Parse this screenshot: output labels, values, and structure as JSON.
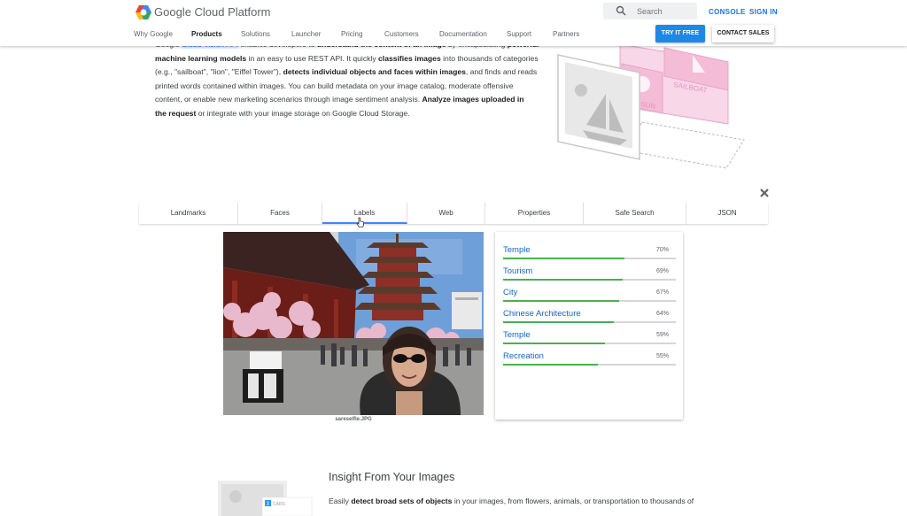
{
  "header": {
    "brand": "Google Cloud Platform",
    "search_placeholder": "Search",
    "console": "CONSOLE",
    "sign_in": "SIGN IN",
    "nav": [
      "Why Google",
      "Products",
      "Solutions",
      "Launcher",
      "Pricing",
      "Customers",
      "Documentation",
      "Support",
      "Partners"
    ],
    "active_nav": "Products",
    "try_free": "TRY IT FREE",
    "contact_sales": "CONTACT SALES"
  },
  "intro": {
    "l1a": "Google ",
    "l1b": "Cloud Vision API",
    "l1c": " enables developers to ",
    "l1d": "understand the content of an image",
    "l1e": " by encapsulating ",
    "l1f": "powerful",
    "l2a": "machine learning models",
    "l2b": " in an easy to use REST API. It quickly ",
    "l2c": "classifies images",
    "l2d": " into thousands of categories",
    "l3a": "(e.g., \"sailboat\", \"lion\", \"Eiffel Tower\"), ",
    "l3b": "detects individual objects and faces within images",
    "l3c": ", and finds and reads",
    "l4": "printed words contained within images. You can build metadata on your image catalog, moderate offensive",
    "l5a": "content, or enable new marketing scenarios through image sentiment analysis. ",
    "l5b": "Analyze images uploaded in",
    "l6a": "the request",
    "l6b": " or integrate with your image storage on Google Cloud Storage."
  },
  "illustration": {
    "sun": "SUN",
    "sailboat": "SAILBOAT"
  },
  "tabs": [
    "Landmarks",
    "Faces",
    "Labels",
    "Web",
    "Properties",
    "Safe Search",
    "JSON"
  ],
  "active_tab": "Labels",
  "photo": {
    "caption": "sareselfie.JPG"
  },
  "labels": [
    {
      "name": "Temple",
      "percent": "70%",
      "score": 0.7
    },
    {
      "name": "Tourism",
      "percent": "69%",
      "score": 0.69
    },
    {
      "name": "City",
      "percent": "67%",
      "score": 0.67
    },
    {
      "name": "Chinese Architecture",
      "percent": "64%",
      "score": 0.64
    },
    {
      "name": "Temple",
      "percent": "59%",
      "score": 0.59
    },
    {
      "name": "Recreation",
      "percent": "55%",
      "score": 0.55
    }
  ],
  "insight": {
    "title": "Insight From Your Images",
    "body_a": "Easily ",
    "body_b": "detect broad sets of objects",
    "body_c": " in your images, from flowers, animals, or transportation to thousands of",
    "mini_badge": "3",
    "mini_text": "CARS"
  },
  "colors": {
    "accent": "#1e88e5",
    "link": "#1565c0",
    "bar": "#4caf50",
    "tab_underline": "#4285f4"
  }
}
